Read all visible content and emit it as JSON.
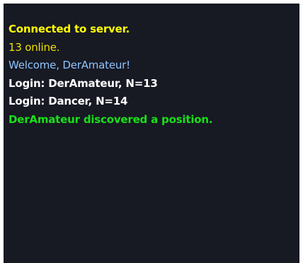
{
  "chat_log": {
    "messages": [
      {
        "text": "Connected to server.",
        "color": "#ffff00",
        "bold": true
      },
      {
        "text": "13 online.",
        "color": "#f0e000",
        "bold": false
      },
      {
        "text": "Welcome, DerAmateur!",
        "color": "#8fc4ff",
        "bold": false
      },
      {
        "text": "Login: DerAmateur, N=13",
        "color": "#ffffff",
        "bold": true
      },
      {
        "text": "Login: Dancer, N=14",
        "color": "#ffffff",
        "bold": true
      },
      {
        "text": "DerAmateur discovered a position.",
        "color": "#18e018",
        "bold": true
      }
    ]
  }
}
